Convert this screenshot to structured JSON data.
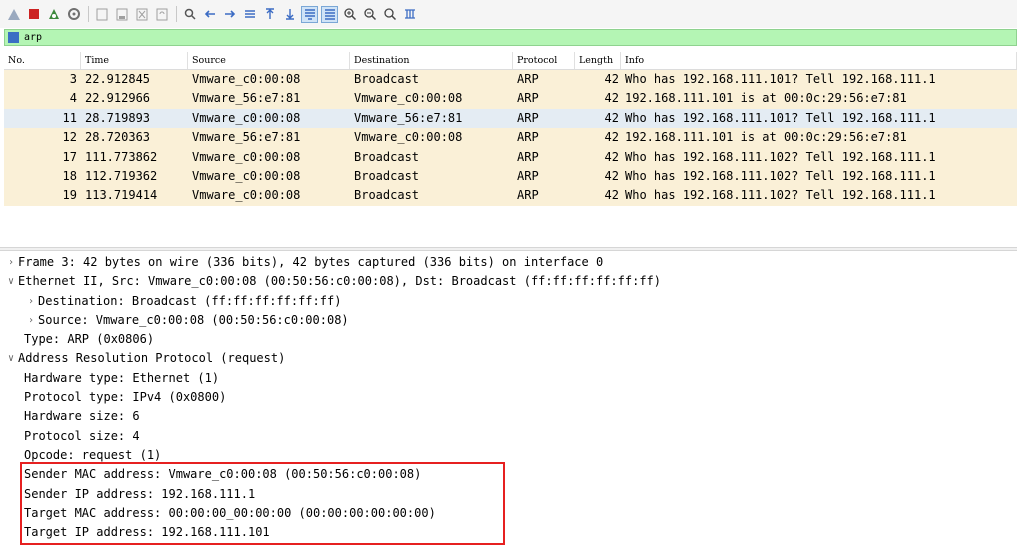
{
  "toolbar": {
    "buttons": [
      {
        "icon": "shark-fin-start-icon",
        "color": "#9aa9bf"
      },
      {
        "icon": "stop-icon",
        "color": "#cc2222"
      },
      {
        "icon": "restart-icon",
        "color": "#3c8a3c"
      },
      {
        "icon": "capture-options-icon",
        "color": "#707070"
      },
      {
        "icon": "open-file-icon",
        "color": "#a0a0a0"
      },
      {
        "icon": "save-file-icon",
        "color": "#a0a0a0"
      },
      {
        "icon": "close-file-icon",
        "color": "#a0a0a0"
      },
      {
        "icon": "reload-icon",
        "color": "#a0a0a0"
      },
      {
        "icon": "find-packet-icon",
        "color": "#555555"
      },
      {
        "icon": "go-back-icon",
        "color": "#3c6cc4"
      },
      {
        "icon": "go-forward-icon",
        "color": "#3c6cc4"
      },
      {
        "icon": "go-to-packet-icon",
        "color": "#3c6cc4"
      },
      {
        "icon": "first-packet-icon",
        "color": "#3c6cc4"
      },
      {
        "icon": "last-packet-icon",
        "color": "#3c6cc4"
      },
      {
        "icon": "auto-scroll-icon",
        "color": "#3c6cc4"
      },
      {
        "icon": "colorize-icon",
        "color": "#3c6cc4"
      },
      {
        "icon": "zoom-in-icon",
        "color": "#444444"
      },
      {
        "icon": "zoom-out-icon",
        "color": "#444444"
      },
      {
        "icon": "normal-size-icon",
        "color": "#444444"
      },
      {
        "icon": "resize-columns-icon",
        "color": "#3c6cc4"
      }
    ]
  },
  "filter": {
    "value": "arp",
    "accent": "#b4f5b4"
  },
  "packet_list": {
    "columns": [
      "No.",
      "Time",
      "Source",
      "Destination",
      "Protocol",
      "Length",
      "Info"
    ],
    "rows": [
      {
        "no": "3",
        "time": "22.912845",
        "src": "Vmware_c0:00:08",
        "dst": "Broadcast",
        "proto": "ARP",
        "len": "42",
        "info": "Who has 192.168.111.101? Tell 192.168.111.1"
      },
      {
        "no": "4",
        "time": "22.912966",
        "src": "Vmware_56:e7:81",
        "dst": "Vmware_c0:00:08",
        "proto": "ARP",
        "len": "42",
        "info": "192.168.111.101 is at 00:0c:29:56:e7:81"
      },
      {
        "no": "11",
        "time": "28.719893",
        "src": "Vmware_c0:00:08",
        "dst": "Vmware_56:e7:81",
        "proto": "ARP",
        "len": "42",
        "info": "Who has 192.168.111.101? Tell 192.168.111.1"
      },
      {
        "no": "12",
        "time": "28.720363",
        "src": "Vmware_56:e7:81",
        "dst": "Vmware_c0:00:08",
        "proto": "ARP",
        "len": "42",
        "info": "192.168.111.101 is at 00:0c:29:56:e7:81"
      },
      {
        "no": "17",
        "time": "111.773862",
        "src": "Vmware_c0:00:08",
        "dst": "Broadcast",
        "proto": "ARP",
        "len": "42",
        "info": "Who has 192.168.111.102? Tell 192.168.111.1"
      },
      {
        "no": "18",
        "time": "112.719362",
        "src": "Vmware_c0:00:08",
        "dst": "Broadcast",
        "proto": "ARP",
        "len": "42",
        "info": "Who has 192.168.111.102? Tell 192.168.111.1"
      },
      {
        "no": "19",
        "time": "113.719414",
        "src": "Vmware_c0:00:08",
        "dst": "Broadcast",
        "proto": "ARP",
        "len": "42",
        "info": "Who has 192.168.111.102? Tell 192.168.111.1"
      }
    ],
    "row_color": "#faf0d7",
    "selected_row_color": "#e4ecf3"
  },
  "details": {
    "rows": [
      {
        "level": "l0",
        "twisty": ">",
        "text": "Frame 3: 42 bytes on wire (336 bits), 42 bytes captured (336 bits) on interface 0"
      },
      {
        "level": "l0",
        "twisty": "v",
        "text": "Ethernet II, Src: Vmware_c0:00:08 (00:50:56:c0:00:08), Dst: Broadcast (ff:ff:ff:ff:ff:ff)"
      },
      {
        "level": "l1",
        "twisty": ">",
        "text": "Destination: Broadcast (ff:ff:ff:ff:ff:ff)"
      },
      {
        "level": "l1",
        "twisty": ">",
        "text": "Source: Vmware_c0:00:08 (00:50:56:c0:00:08)"
      },
      {
        "level": "leaf1",
        "twisty": "",
        "text": "Type: ARP (0x0806)"
      },
      {
        "level": "l0",
        "twisty": "v",
        "text": "Address Resolution Protocol (request)"
      },
      {
        "level": "leaf1",
        "twisty": "",
        "text": "Hardware type: Ethernet (1)"
      },
      {
        "level": "leaf1",
        "twisty": "",
        "text": "Protocol type: IPv4 (0x0800)"
      },
      {
        "level": "leaf1",
        "twisty": "",
        "text": "Hardware size: 6"
      },
      {
        "level": "leaf1",
        "twisty": "",
        "text": "Protocol size: 4"
      },
      {
        "level": "leaf1",
        "twisty": "",
        "text": "Opcode: request (1)"
      },
      {
        "level": "leaf1",
        "twisty": "",
        "text": "Sender MAC address: Vmware_c0:00:08 (00:50:56:c0:00:08)"
      },
      {
        "level": "leaf1",
        "twisty": "",
        "text": "Sender IP address: 192.168.111.1"
      },
      {
        "level": "leaf1",
        "twisty": "",
        "text": "Target MAC address: 00:00:00_00:00:00 (00:00:00:00:00:00)"
      },
      {
        "level": "leaf1",
        "twisty": "",
        "text": "Target IP address: 192.168.111.101"
      }
    ],
    "highlight_color": "#e62020"
  }
}
